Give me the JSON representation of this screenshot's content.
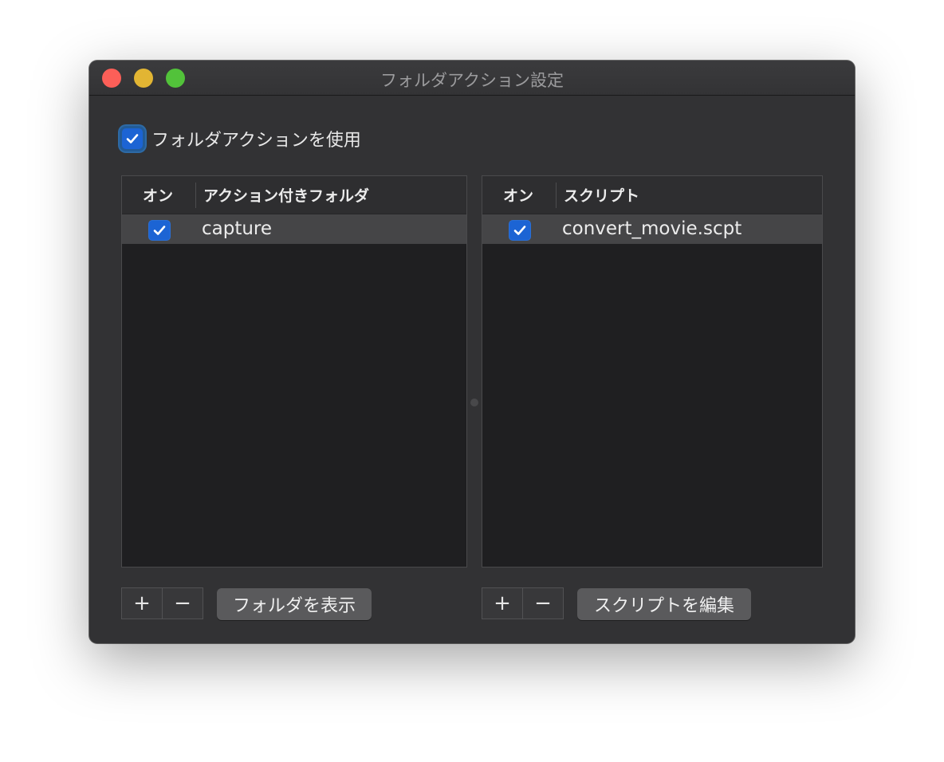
{
  "window": {
    "title": "フォルダアクション設定"
  },
  "use_folder_actions": {
    "label": "フォルダアクションを使用",
    "checked": true
  },
  "folders_table": {
    "columns": [
      "オン",
      "アクション付きフォルダ"
    ],
    "rows": [
      {
        "on": true,
        "name": "capture"
      }
    ]
  },
  "scripts_table": {
    "columns": [
      "オン",
      "スクリプト"
    ],
    "rows": [
      {
        "on": true,
        "name": "convert_movie.scpt"
      }
    ]
  },
  "folder_controls": {
    "add": "+",
    "remove": "−",
    "show_label": "フォルダを表示"
  },
  "script_controls": {
    "add": "+",
    "remove": "−",
    "edit_label": "スクリプトを編集"
  },
  "colors": {
    "accent": "#1c64d4",
    "window_bg": "#323234",
    "table_bg": "#1f1f21",
    "selected_row": "#454547"
  }
}
